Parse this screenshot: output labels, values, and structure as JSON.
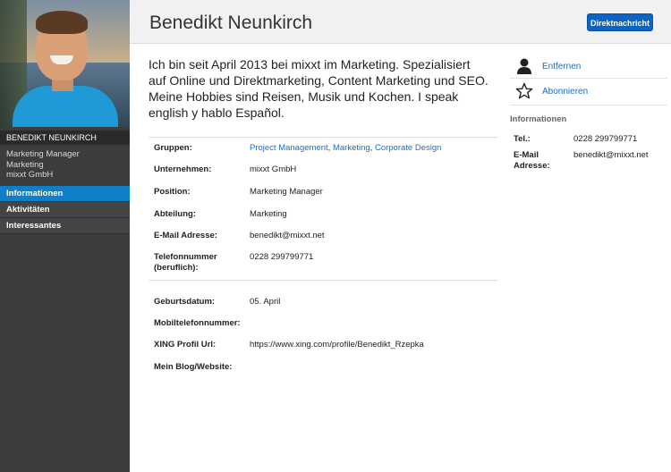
{
  "profile": {
    "name": "Benedikt Neunkirch",
    "bio": "Ich bin seit April 2013 bei mixxt im Marketing. Spezialisiert auf Online und Direktmarketing, Content Marketing und SEO. Meine Hobbies sind Reisen, Musik und Kochen. I speak english y hablo Español."
  },
  "header": {
    "dm_button": "Direktnachricht"
  },
  "sidebar": {
    "name_caps": "BENEDIKT NEUNKIRCH",
    "meta": [
      "Marketing Manager",
      "Marketing",
      "mixxt GmbH"
    ],
    "items": [
      {
        "label": "Informationen",
        "active": true
      },
      {
        "label": "Aktivitäten",
        "active": false
      },
      {
        "label": "Interessantes",
        "active": false
      }
    ]
  },
  "details": {
    "groups_label": "Gruppen:",
    "groups": [
      "Project Management",
      "Marketing",
      "Corporate Design"
    ],
    "company_label": "Unternehmen:",
    "company": "mixxt GmbH",
    "position_label": "Position:",
    "position": "Marketing Manager",
    "department_label": "Abteilung:",
    "department": "Marketing",
    "email_label": "E-Mail Adresse:",
    "email": "benedikt@mixxt.net",
    "phone_label_1": "Telefonnummer",
    "phone_label_2": "(beruflich):",
    "phone": "0228 299799771",
    "birthday_label": "Geburtsdatum:",
    "birthday": "05. April",
    "mobile_label": "Mobiltelefonnummer:",
    "xing_label": "XING Profil Url:",
    "xing": "https://www.xing.com/profile/Benedikt_Rzepka",
    "blog_label": "Mein Blog/Website:"
  },
  "right": {
    "remove": "Entfernen",
    "subscribe": "Abonnieren",
    "info_heading": "Informationen",
    "tel_label": "Tel.:",
    "tel": "0228 299799771",
    "email_label_1": "E-Mail",
    "email_label_2": "Adresse:",
    "email": "benedikt@mixxt.net"
  },
  "icons": {
    "remove": "person-icon",
    "subscribe": "star-icon"
  },
  "colors": {
    "accent": "#0e7fc8",
    "button": "#0e63c2",
    "link": "#1a6cc8",
    "sidebar": "#3c3c3c"
  }
}
